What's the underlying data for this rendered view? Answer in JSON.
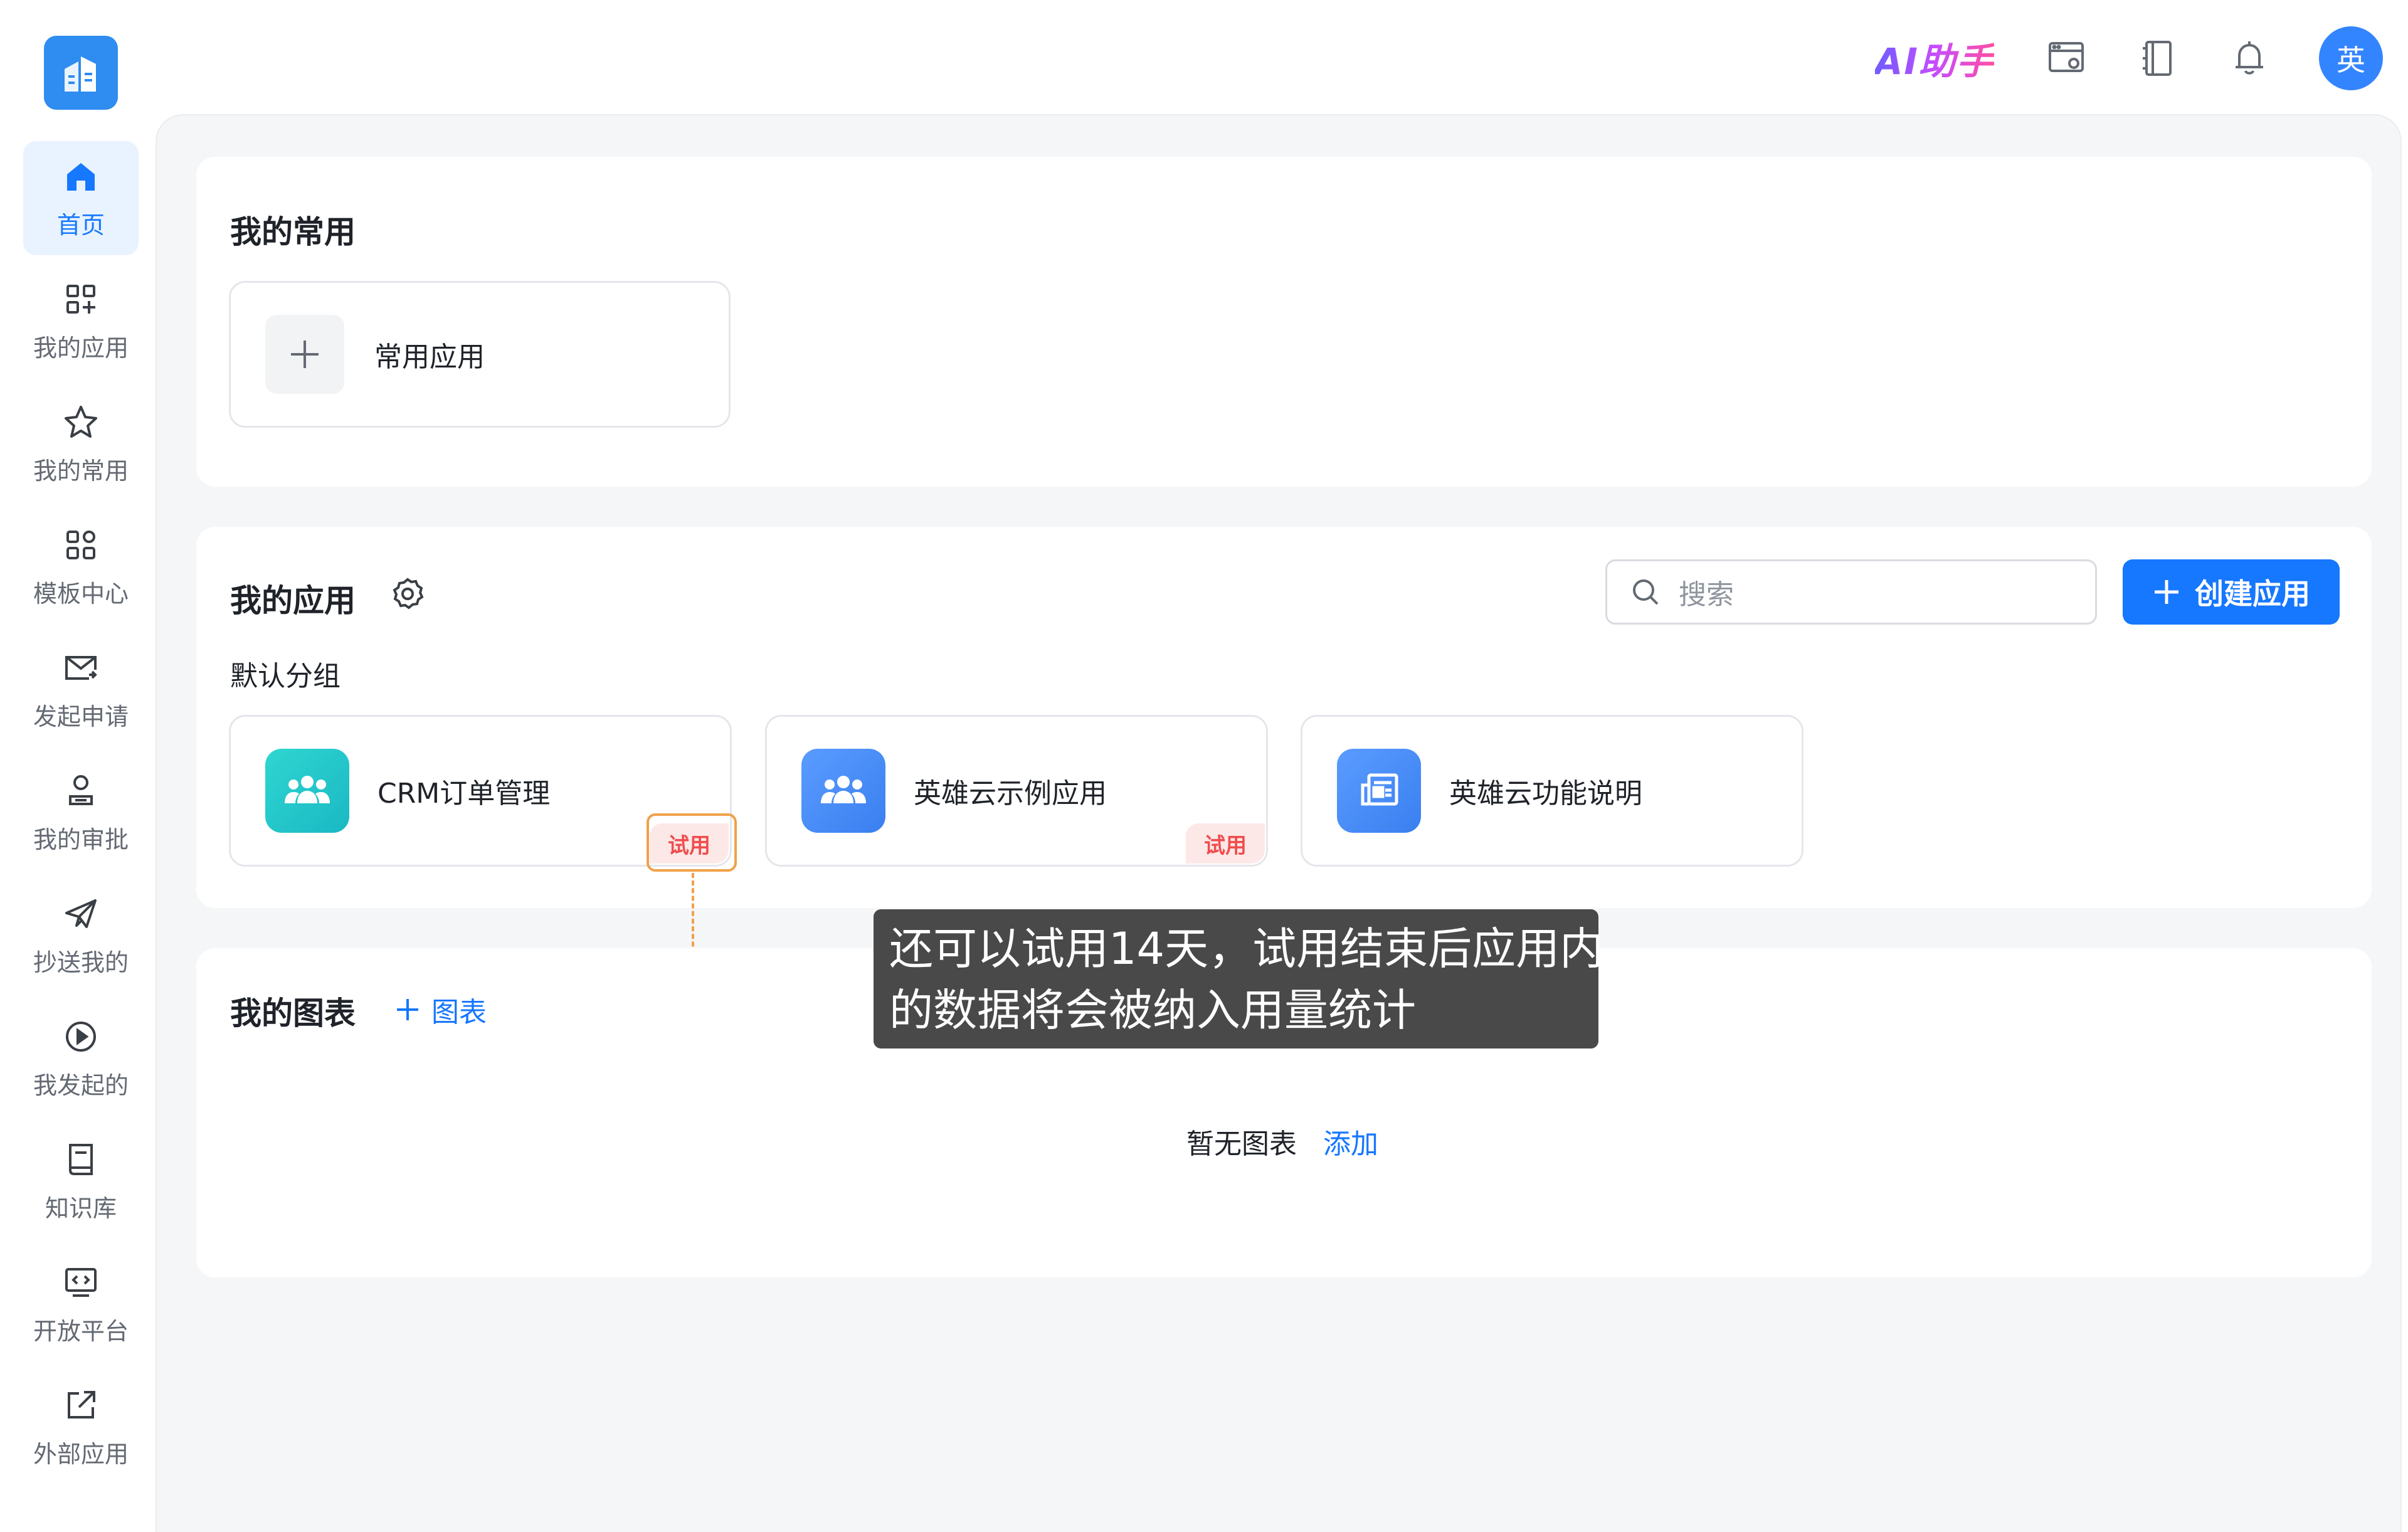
{
  "header": {
    "ai_assistant": "AI助手",
    "avatar_text": "英"
  },
  "sidebar": {
    "items": [
      {
        "label": "首页",
        "icon": "home-icon",
        "active": true
      },
      {
        "label": "我的应用",
        "icon": "apps-grid-plus-icon",
        "active": false
      },
      {
        "label": "我的常用",
        "icon": "star-icon",
        "active": false
      },
      {
        "label": "模板中心",
        "icon": "template-grid-icon",
        "active": false
      },
      {
        "label": "发起申请",
        "icon": "mail-send-icon",
        "active": false
      },
      {
        "label": "我的审批",
        "icon": "person-approve-icon",
        "active": false
      },
      {
        "label": "抄送我的",
        "icon": "paper-plane-icon",
        "active": false
      },
      {
        "label": "我发起的",
        "icon": "play-circle-icon",
        "active": false
      },
      {
        "label": "知识库",
        "icon": "book-icon",
        "active": false
      },
      {
        "label": "开放平台",
        "icon": "code-monitor-icon",
        "active": false
      },
      {
        "label": "外部应用",
        "icon": "external-link-icon",
        "active": false
      }
    ]
  },
  "favorites": {
    "title": "我的常用",
    "add_card_label": "常用应用"
  },
  "my_apps": {
    "title": "我的应用",
    "group_label": "默认分组",
    "search_placeholder": "搜索",
    "create_button": "创建应用",
    "apps": [
      {
        "name": "CRM订单管理",
        "badge": "试用",
        "color": "#1fc6c8"
      },
      {
        "name": "英雄云示例应用",
        "badge": "试用",
        "color": "#3f8bf5"
      },
      {
        "name": "英雄云功能说明",
        "badge": "",
        "color": "#3f8bf5"
      }
    ]
  },
  "charts": {
    "title": "我的图表",
    "add_chart": "图表",
    "empty_text": "暂无图表",
    "add_link": "添加"
  },
  "tooltip": {
    "line1": "还可以试用14天，试用结束后应用内",
    "line2": "的数据将会被纳入用量统计"
  },
  "colors": {
    "primary": "#1677ff",
    "trial_badge_bg": "#fde8e8",
    "trial_badge_text": "#f04d4d",
    "highlight": "#f0a14a"
  }
}
